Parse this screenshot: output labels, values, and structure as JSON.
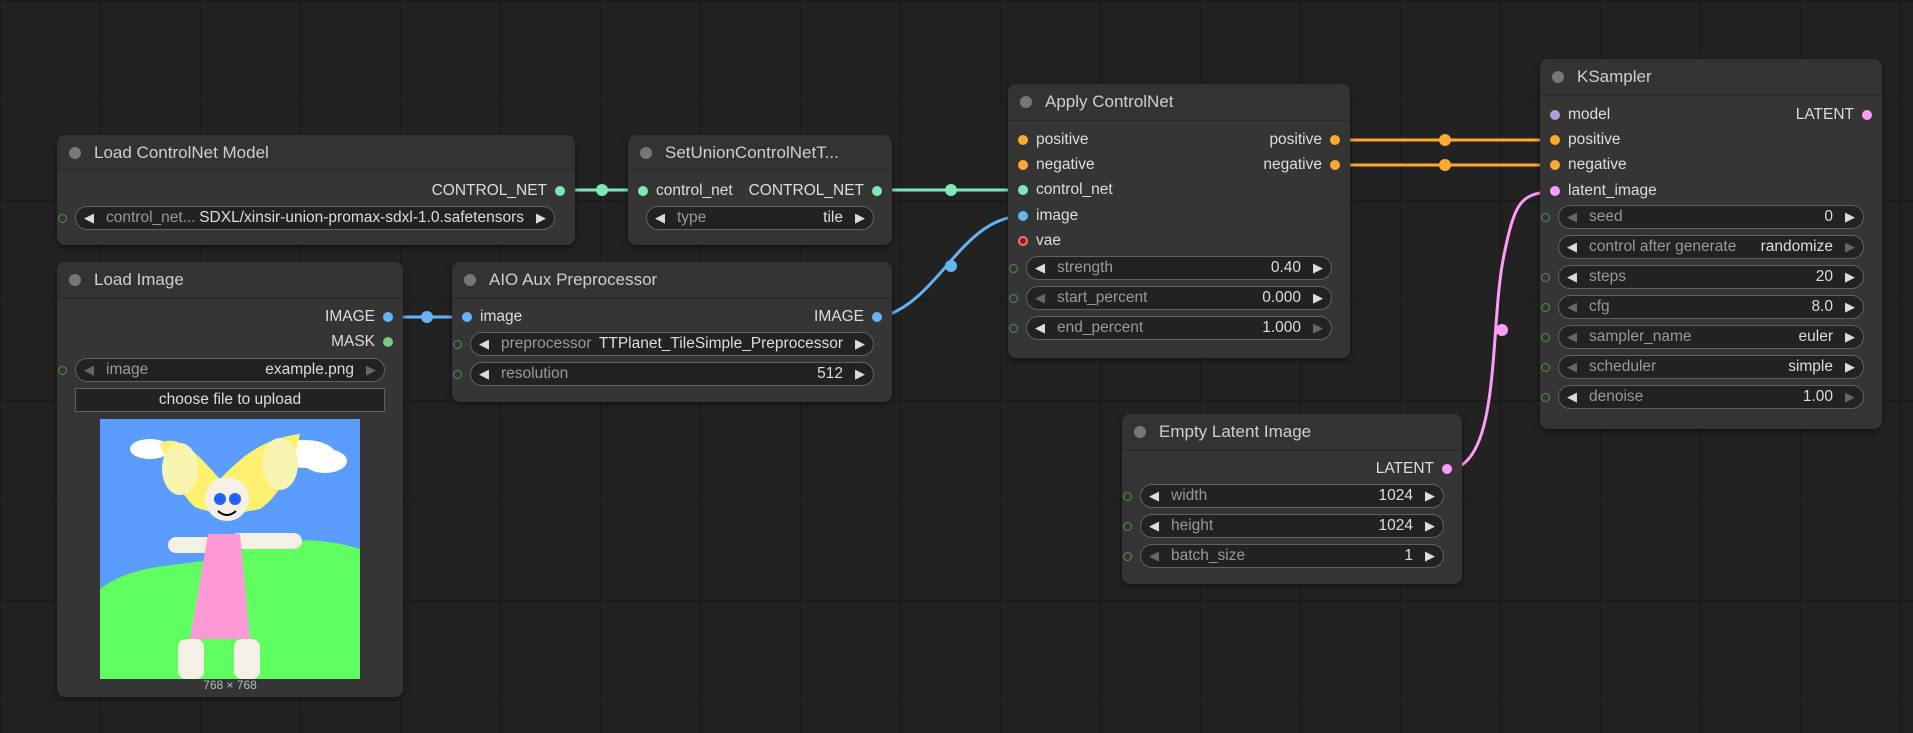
{
  "colors": {
    "control_net": "#7ee8b8",
    "image": "#64b5f6",
    "mask": "#81c784",
    "conditioning": "#ffa931",
    "latent": "#ff9cf9",
    "model": "#b39ddb",
    "vae": "#ff6e6e"
  },
  "nodes": {
    "load_controlnet": {
      "title": "Load ControlNet Model",
      "output": "CONTROL_NET",
      "widget_label": "control_net...",
      "widget_value": "SDXL/xinsir-union-promax-sdxl-1.0.safetensors"
    },
    "set_union": {
      "title": "SetUnionControlNetT...",
      "input": "control_net",
      "output": "CONTROL_NET",
      "widget_label": "type",
      "widget_value": "tile"
    },
    "load_image": {
      "title": "Load Image",
      "output_image": "IMAGE",
      "output_mask": "MASK",
      "widget_label": "image",
      "widget_value": "example.png",
      "upload_label": "choose file to upload",
      "image_size": "768 × 768"
    },
    "aio_aux": {
      "title": "AIO Aux Preprocessor",
      "input": "image",
      "output": "IMAGE",
      "preprocessor_label": "preprocessor",
      "preprocessor_value": "TTPlanet_TileSimple_Preprocessor",
      "resolution_label": "resolution",
      "resolution_value": "512"
    },
    "apply_controlnet": {
      "title": "Apply ControlNet",
      "inputs": [
        "positive",
        "negative",
        "control_net",
        "image",
        "vae"
      ],
      "outputs": [
        "positive",
        "negative"
      ],
      "widgets": [
        {
          "label": "strength",
          "value": "0.40"
        },
        {
          "label": "start_percent",
          "value": "0.000"
        },
        {
          "label": "end_percent",
          "value": "1.000"
        }
      ]
    },
    "ksampler": {
      "title": "KSampler",
      "inputs": [
        "model",
        "positive",
        "negative",
        "latent_image"
      ],
      "output": "LATENT",
      "widgets": [
        {
          "label": "seed",
          "value": "0"
        },
        {
          "label": "control after generate",
          "value": "randomize"
        },
        {
          "label": "steps",
          "value": "20"
        },
        {
          "label": "cfg",
          "value": "8.0"
        },
        {
          "label": "sampler_name",
          "value": "euler"
        },
        {
          "label": "scheduler",
          "value": "simple"
        },
        {
          "label": "denoise",
          "value": "1.00"
        }
      ]
    },
    "empty_latent": {
      "title": "Empty Latent Image",
      "output": "LATENT",
      "widgets": [
        {
          "label": "width",
          "value": "1024"
        },
        {
          "label": "height",
          "value": "1024"
        },
        {
          "label": "batch_size",
          "value": "1"
        }
      ]
    }
  }
}
